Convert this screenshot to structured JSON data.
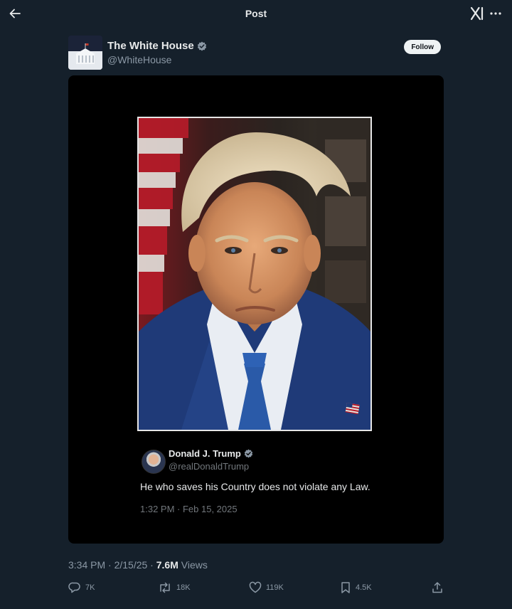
{
  "header": {
    "title": "Post"
  },
  "post": {
    "author_name": "The White House",
    "author_handle": "@WhiteHouse",
    "follow_label": "Follow",
    "timestamp": "3:34 PM · 2/15/25 · ",
    "views_count": "7.6M",
    "views_label": " Views"
  },
  "quoted": {
    "author_name": "Donald J. Trump",
    "author_handle": "@realDonaldTrump",
    "text": "He who saves his Country does not violate any Law.",
    "timestamp": "1:32 PM · Feb 15, 2025"
  },
  "actions": {
    "replies": "7K",
    "reposts": "18K",
    "likes": "119K",
    "bookmarks": "4.5K"
  },
  "colors": {
    "background": "#15202b",
    "media_background": "#000000",
    "verified_badge": "#8b98a5"
  },
  "icons": [
    "back-arrow-icon",
    "x-logo-icon",
    "more-icon",
    "verified-badge-icon",
    "reply-icon",
    "repost-icon",
    "like-icon",
    "bookmark-icon",
    "share-icon"
  ]
}
